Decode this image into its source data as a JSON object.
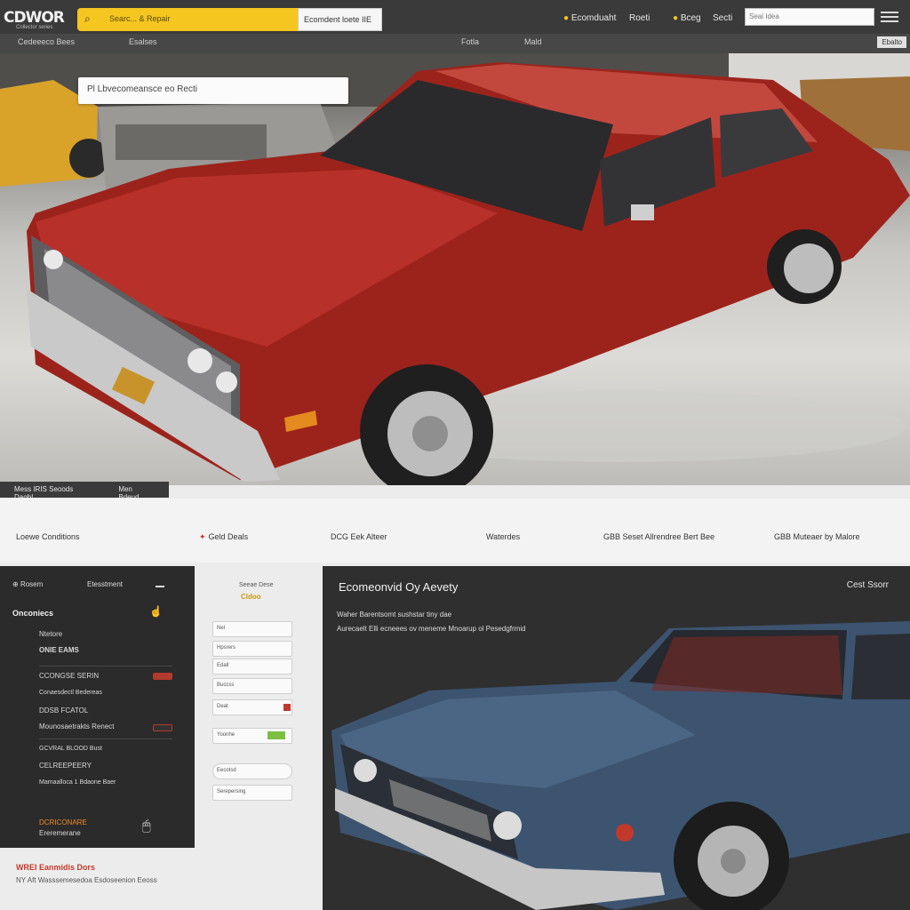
{
  "header": {
    "logo": "CDWOR",
    "logo_sub": "Collector series",
    "search_text": "Searc... & Repair",
    "search_button": "Ecomdent loete IIE",
    "nav": [
      "Ecomduaht",
      "Roeti",
      "Bceg",
      "Secti"
    ],
    "top_input": "Seai Idea",
    "sub_items": [
      "Cedeeeco Bees",
      "Esalses",
      "Fotla",
      "Mald"
    ],
    "sub_badge": "Ebalto"
  },
  "hero": {
    "search_text": "Pl Lbvecomeansce eo Recti",
    "tag1": "Mess IRIS Seoods Daob!",
    "tag2": "Men Bdeud"
  },
  "features": [
    "Loewe Conditions",
    "Geld Deals",
    "DCG Eek Alteer",
    "Waterdes",
    "GBB Seset Allrendree Bert Bee",
    "GBB Muteaer by Malore"
  ],
  "left_panel": {
    "head1": "Rosem",
    "head2": "Etesstment",
    "title": "Onconiecs",
    "rows": [
      "Ntetore",
      "ONIE EAMS",
      "CCONGSE SERIN",
      "Conaesdectl Bedereas",
      "DDSB FCATOL",
      "Mounosaetrakts Renect",
      "GCVRAL BLOOD Bust",
      "CELREEPEERY",
      "Mamaalloca 1 Bdaone Baer",
      "DCRICONARE",
      "Ereremerane"
    ]
  },
  "mid_col": {
    "head": "Seeae Dese",
    "badge": "Cldoo",
    "fields": [
      "Nel",
      "Hpsrers",
      "Edall",
      "Buccss",
      "Deat",
      "Yoonhe",
      "Eecotsd",
      "Serepersing"
    ]
  },
  "promo": {
    "title": "Ecomeonvid Oy Aevety",
    "nav": "Cest  Ssorr",
    "sub1": "Waher Barentsomt sushstar tiny dae",
    "sub2": "Aurecaelt Elli ecneees ov meneme Mnoarup ol Pesedgfrmid"
  },
  "footer": {
    "line1": "WREI Eanmidis Dors",
    "line2": "NY Aft Wasssemesedoa Esdoseenion Eeoss"
  }
}
